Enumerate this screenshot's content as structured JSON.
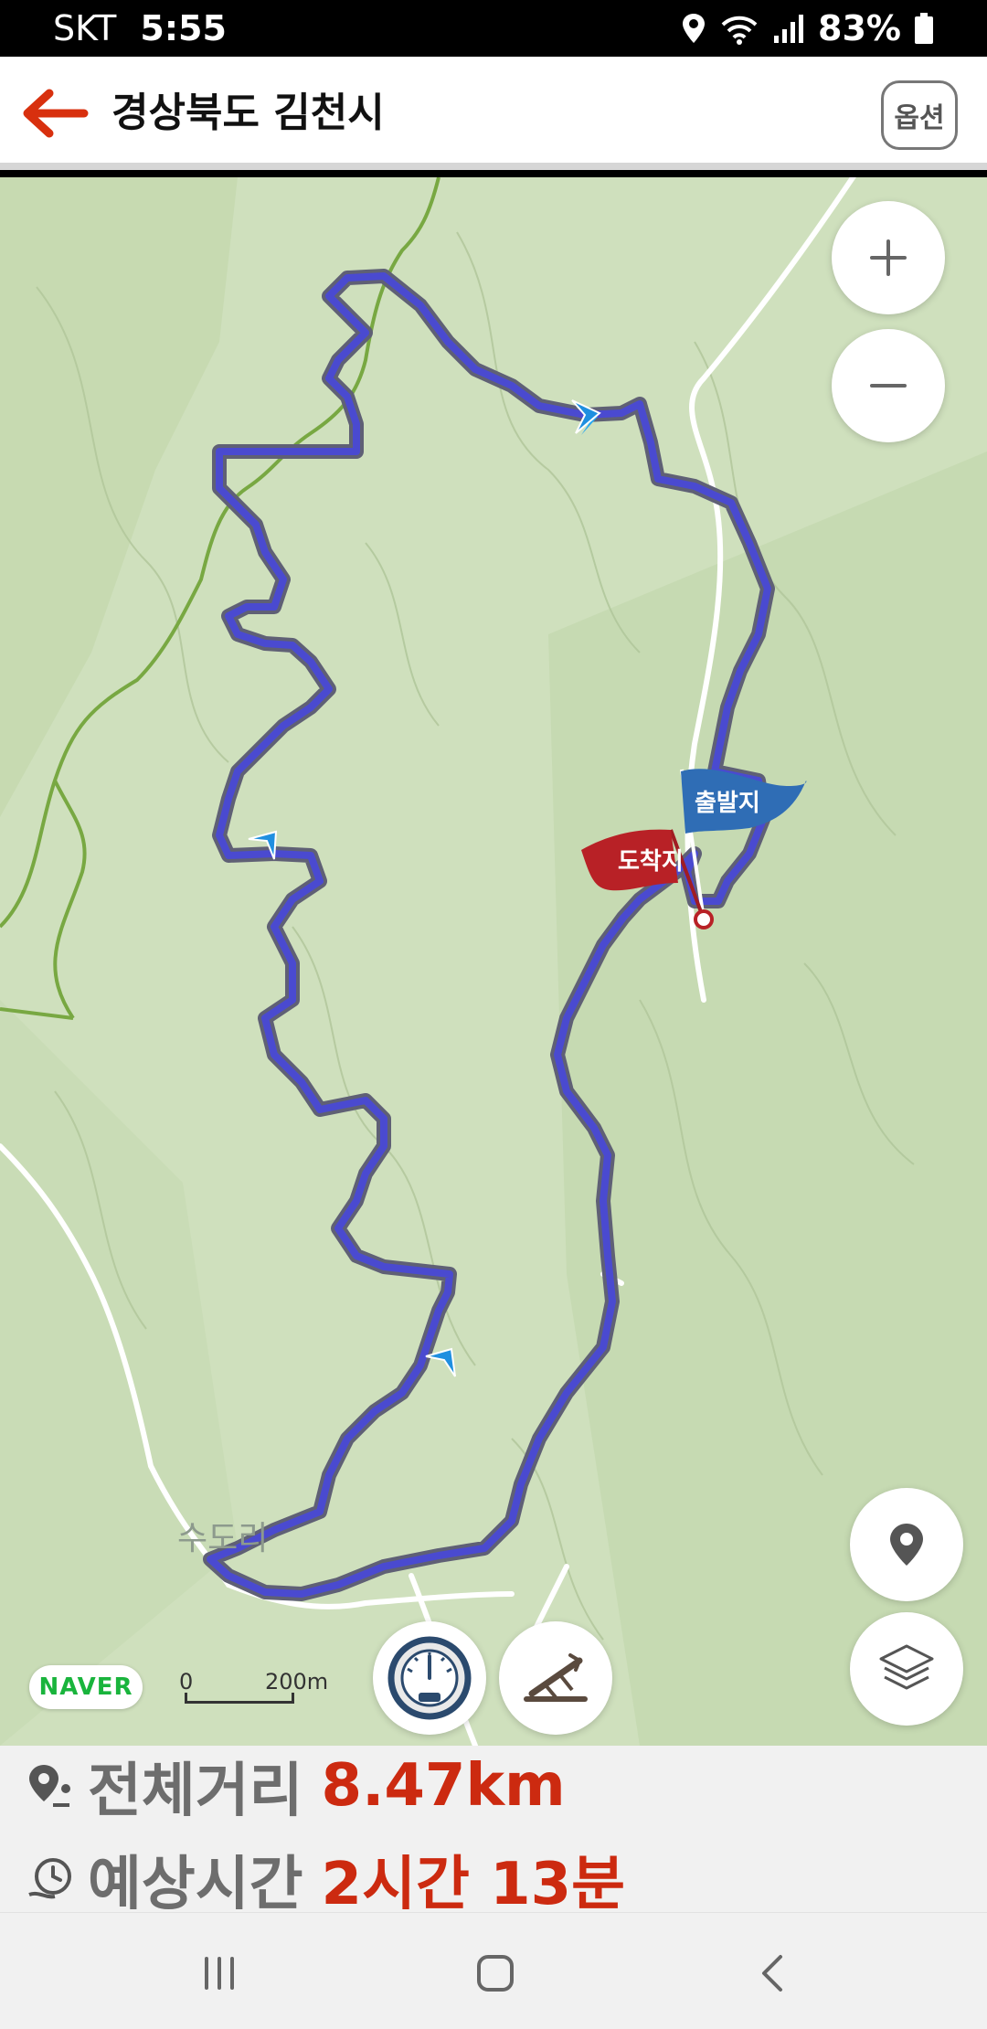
{
  "status": {
    "carrier": "SKT",
    "time": "5:55",
    "battery": "83%"
  },
  "header": {
    "title": "경상북도 김천시",
    "option_label": "옵션"
  },
  "map": {
    "start_flag": "출발지",
    "end_flag": "도착지",
    "place_label": "수도리",
    "logo": "NAVER",
    "scale_start": "0",
    "scale_end": "200m",
    "route_color": "#4444c8",
    "start_flag_color": "#2f6db5",
    "end_flag_color": "#b82126"
  },
  "info": {
    "distance_label": "전체거리",
    "distance_value": "8.47km",
    "time_label": "예상시간",
    "time_value": "2시간 13분",
    "accent_color": "#cc2a10"
  },
  "icons": [
    "back-arrow-icon",
    "plus-icon",
    "minus-icon",
    "location-pin-icon",
    "layers-icon",
    "speedometer-icon",
    "slope-icon",
    "distance-pin-icon",
    "clock-icon"
  ]
}
